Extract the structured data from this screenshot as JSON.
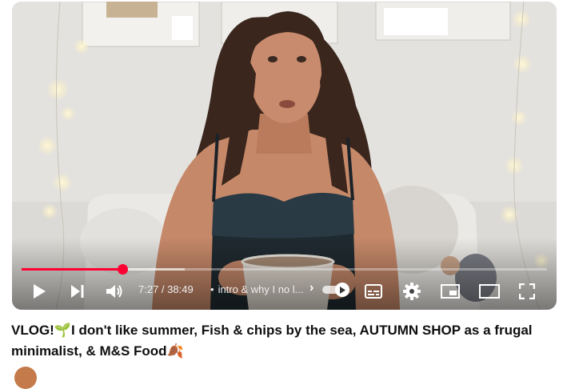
{
  "player": {
    "current_time": "7:27",
    "duration": "38:49",
    "time_separator": " / ",
    "chapter_bullet": "•",
    "chapter_title": "intro & why I no l...",
    "chapter_arrow": "›",
    "progress_fraction": 0.192,
    "buffered_fraction": 0.31,
    "accent_color": "#ff0033",
    "autoplay": "on",
    "icons": [
      "play-icon",
      "next-icon",
      "volume-icon",
      "autoplay-toggle",
      "subtitles-icon",
      "settings-icon",
      "miniplayer-icon",
      "theater-mode-icon",
      "fullscreen-icon"
    ]
  },
  "video": {
    "title": "VLOG!🌱I don't like summer, Fish & chips by the sea, AUTUMN SHOP as a frugal minimalist, & M&S Food🍂"
  }
}
